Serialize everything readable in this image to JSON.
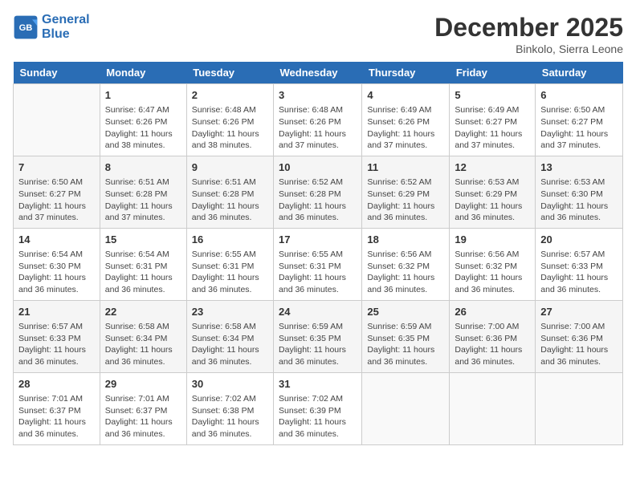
{
  "header": {
    "logo_line1": "General",
    "logo_line2": "Blue",
    "month": "December 2025",
    "location": "Binkolo, Sierra Leone"
  },
  "days_of_week": [
    "Sunday",
    "Monday",
    "Tuesday",
    "Wednesday",
    "Thursday",
    "Friday",
    "Saturday"
  ],
  "weeks": [
    [
      {
        "day": "",
        "sunrise": "",
        "sunset": "",
        "daylight": ""
      },
      {
        "day": "1",
        "sunrise": "Sunrise: 6:47 AM",
        "sunset": "Sunset: 6:26 PM",
        "daylight": "Daylight: 11 hours and 38 minutes."
      },
      {
        "day": "2",
        "sunrise": "Sunrise: 6:48 AM",
        "sunset": "Sunset: 6:26 PM",
        "daylight": "Daylight: 11 hours and 38 minutes."
      },
      {
        "day": "3",
        "sunrise": "Sunrise: 6:48 AM",
        "sunset": "Sunset: 6:26 PM",
        "daylight": "Daylight: 11 hours and 37 minutes."
      },
      {
        "day": "4",
        "sunrise": "Sunrise: 6:49 AM",
        "sunset": "Sunset: 6:26 PM",
        "daylight": "Daylight: 11 hours and 37 minutes."
      },
      {
        "day": "5",
        "sunrise": "Sunrise: 6:49 AM",
        "sunset": "Sunset: 6:27 PM",
        "daylight": "Daylight: 11 hours and 37 minutes."
      },
      {
        "day": "6",
        "sunrise": "Sunrise: 6:50 AM",
        "sunset": "Sunset: 6:27 PM",
        "daylight": "Daylight: 11 hours and 37 minutes."
      }
    ],
    [
      {
        "day": "7",
        "sunrise": "Sunrise: 6:50 AM",
        "sunset": "Sunset: 6:27 PM",
        "daylight": "Daylight: 11 hours and 37 minutes."
      },
      {
        "day": "8",
        "sunrise": "Sunrise: 6:51 AM",
        "sunset": "Sunset: 6:28 PM",
        "daylight": "Daylight: 11 hours and 37 minutes."
      },
      {
        "day": "9",
        "sunrise": "Sunrise: 6:51 AM",
        "sunset": "Sunset: 6:28 PM",
        "daylight": "Daylight: 11 hours and 36 minutes."
      },
      {
        "day": "10",
        "sunrise": "Sunrise: 6:52 AM",
        "sunset": "Sunset: 6:28 PM",
        "daylight": "Daylight: 11 hours and 36 minutes."
      },
      {
        "day": "11",
        "sunrise": "Sunrise: 6:52 AM",
        "sunset": "Sunset: 6:29 PM",
        "daylight": "Daylight: 11 hours and 36 minutes."
      },
      {
        "day": "12",
        "sunrise": "Sunrise: 6:53 AM",
        "sunset": "Sunset: 6:29 PM",
        "daylight": "Daylight: 11 hours and 36 minutes."
      },
      {
        "day": "13",
        "sunrise": "Sunrise: 6:53 AM",
        "sunset": "Sunset: 6:30 PM",
        "daylight": "Daylight: 11 hours and 36 minutes."
      }
    ],
    [
      {
        "day": "14",
        "sunrise": "Sunrise: 6:54 AM",
        "sunset": "Sunset: 6:30 PM",
        "daylight": "Daylight: 11 hours and 36 minutes."
      },
      {
        "day": "15",
        "sunrise": "Sunrise: 6:54 AM",
        "sunset": "Sunset: 6:31 PM",
        "daylight": "Daylight: 11 hours and 36 minutes."
      },
      {
        "day": "16",
        "sunrise": "Sunrise: 6:55 AM",
        "sunset": "Sunset: 6:31 PM",
        "daylight": "Daylight: 11 hours and 36 minutes."
      },
      {
        "day": "17",
        "sunrise": "Sunrise: 6:55 AM",
        "sunset": "Sunset: 6:31 PM",
        "daylight": "Daylight: 11 hours and 36 minutes."
      },
      {
        "day": "18",
        "sunrise": "Sunrise: 6:56 AM",
        "sunset": "Sunset: 6:32 PM",
        "daylight": "Daylight: 11 hours and 36 minutes."
      },
      {
        "day": "19",
        "sunrise": "Sunrise: 6:56 AM",
        "sunset": "Sunset: 6:32 PM",
        "daylight": "Daylight: 11 hours and 36 minutes."
      },
      {
        "day": "20",
        "sunrise": "Sunrise: 6:57 AM",
        "sunset": "Sunset: 6:33 PM",
        "daylight": "Daylight: 11 hours and 36 minutes."
      }
    ],
    [
      {
        "day": "21",
        "sunrise": "Sunrise: 6:57 AM",
        "sunset": "Sunset: 6:33 PM",
        "daylight": "Daylight: 11 hours and 36 minutes."
      },
      {
        "day": "22",
        "sunrise": "Sunrise: 6:58 AM",
        "sunset": "Sunset: 6:34 PM",
        "daylight": "Daylight: 11 hours and 36 minutes."
      },
      {
        "day": "23",
        "sunrise": "Sunrise: 6:58 AM",
        "sunset": "Sunset: 6:34 PM",
        "daylight": "Daylight: 11 hours and 36 minutes."
      },
      {
        "day": "24",
        "sunrise": "Sunrise: 6:59 AM",
        "sunset": "Sunset: 6:35 PM",
        "daylight": "Daylight: 11 hours and 36 minutes."
      },
      {
        "day": "25",
        "sunrise": "Sunrise: 6:59 AM",
        "sunset": "Sunset: 6:35 PM",
        "daylight": "Daylight: 11 hours and 36 minutes."
      },
      {
        "day": "26",
        "sunrise": "Sunrise: 7:00 AM",
        "sunset": "Sunset: 6:36 PM",
        "daylight": "Daylight: 11 hours and 36 minutes."
      },
      {
        "day": "27",
        "sunrise": "Sunrise: 7:00 AM",
        "sunset": "Sunset: 6:36 PM",
        "daylight": "Daylight: 11 hours and 36 minutes."
      }
    ],
    [
      {
        "day": "28",
        "sunrise": "Sunrise: 7:01 AM",
        "sunset": "Sunset: 6:37 PM",
        "daylight": "Daylight: 11 hours and 36 minutes."
      },
      {
        "day": "29",
        "sunrise": "Sunrise: 7:01 AM",
        "sunset": "Sunset: 6:37 PM",
        "daylight": "Daylight: 11 hours and 36 minutes."
      },
      {
        "day": "30",
        "sunrise": "Sunrise: 7:02 AM",
        "sunset": "Sunset: 6:38 PM",
        "daylight": "Daylight: 11 hours and 36 minutes."
      },
      {
        "day": "31",
        "sunrise": "Sunrise: 7:02 AM",
        "sunset": "Sunset: 6:39 PM",
        "daylight": "Daylight: 11 hours and 36 minutes."
      },
      {
        "day": "",
        "sunrise": "",
        "sunset": "",
        "daylight": ""
      },
      {
        "day": "",
        "sunrise": "",
        "sunset": "",
        "daylight": ""
      },
      {
        "day": "",
        "sunrise": "",
        "sunset": "",
        "daylight": ""
      }
    ]
  ]
}
